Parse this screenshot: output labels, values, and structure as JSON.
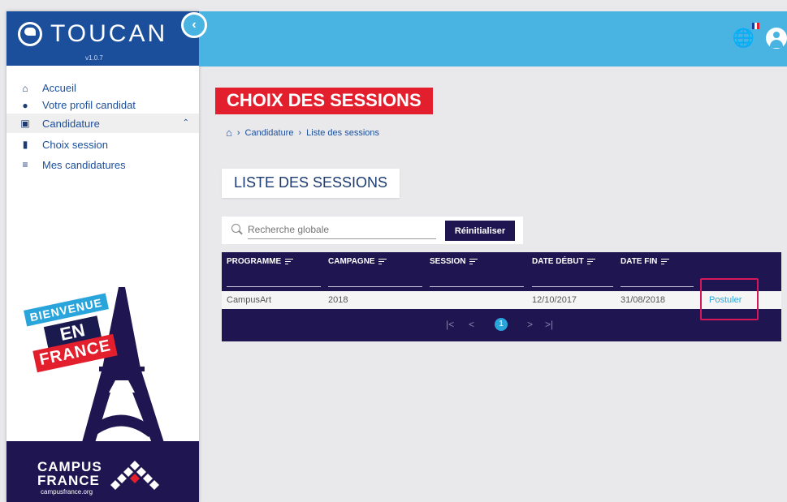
{
  "app": {
    "name": "TOUCAN",
    "version": "v1.0.7"
  },
  "sidebar": {
    "items": [
      {
        "label": "Accueil",
        "icon": "home-icon"
      },
      {
        "label": "Votre profil candidat",
        "icon": "user-icon"
      },
      {
        "label": "Candidature",
        "icon": "form-icon",
        "expanded": true
      },
      {
        "label": "Choix session",
        "icon": "book-icon"
      },
      {
        "label": "Mes candidatures",
        "icon": "list-icon"
      }
    ],
    "poster": {
      "line1": "BIENVENUE",
      "line2": "EN",
      "line3": "FRANCE",
      "brand1": "CAMPUS",
      "brand2": "FRANCE",
      "url": "campusfrance.org"
    }
  },
  "header": {
    "flag_colors": [
      "#1b3b9c",
      "#ffffff",
      "#e41f2d"
    ]
  },
  "page": {
    "title": "CHOIX DES SESSIONS",
    "breadcrumb": [
      "Candidature",
      "Liste des sessions"
    ],
    "section_title": "LISTE DES SESSIONS"
  },
  "search": {
    "placeholder": "Recherche globale",
    "value": "",
    "reset_label": "Réinitialiser"
  },
  "table": {
    "columns": [
      "PROGRAMME",
      "CAMPAGNE",
      "SESSION",
      "DATE DÉBUT",
      "DATE FIN"
    ],
    "rows": [
      {
        "programme": "CampusArt",
        "campagne": "2018",
        "session": "",
        "date_debut": "12/10/2017",
        "date_fin": "31/08/2018",
        "action": "Postuler"
      }
    ],
    "pagination": {
      "current": "1",
      "first": "|<",
      "prev": "<",
      "next": ">",
      "last": ">|"
    }
  },
  "colors": {
    "primary": "#1b4f9c",
    "header": "#49b3e2",
    "accent": "#e41f2d",
    "table": "#1f1550",
    "link": "#2aa5dc"
  }
}
